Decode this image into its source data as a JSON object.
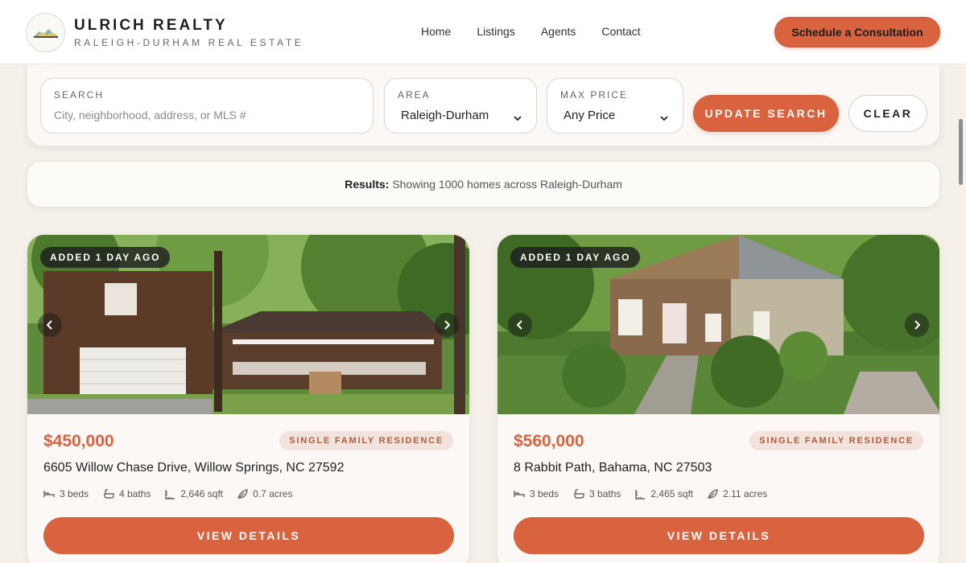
{
  "brand": {
    "name": "ULRICH REALTY",
    "tagline": "RALEIGH-DURHAM REAL ESTATE",
    "logo_icon": "house-logo-icon"
  },
  "nav": {
    "items": [
      {
        "label": "Home"
      },
      {
        "label": "Listings"
      },
      {
        "label": "Agents"
      },
      {
        "label": "Contact"
      }
    ],
    "cta_label": "Schedule a Consultation"
  },
  "search": {
    "search_label": "SEARCH",
    "search_placeholder": "City, neighborhood, address, or MLS #",
    "search_value": "",
    "area_label": "AREA",
    "area_value": "Raleigh-Durham",
    "price_label": "MAX PRICE",
    "price_value": "Any Price",
    "update_label": "UPDATE SEARCH",
    "clear_label": "CLEAR"
  },
  "results": {
    "prefix": "Results:",
    "text": "Showing 1000 homes across Raleigh-Durham"
  },
  "listings": [
    {
      "added": "ADDED 1 DAY AGO",
      "price": "$450,000",
      "type": "SINGLE FAMILY RESIDENCE",
      "address": "6605 Willow Chase Drive, Willow Springs, NC 27592",
      "beds": "3 beds",
      "baths": "4 baths",
      "sqft": "2,646 sqft",
      "acres": "0.7 acres",
      "button": "VIEW DETAILS"
    },
    {
      "added": "ADDED 1 DAY AGO",
      "price": "$560,000",
      "type": "SINGLE FAMILY RESIDENCE",
      "address": "8 Rabbit Path, Bahama, NC 27503",
      "beds": "3 beds",
      "baths": "3 baths",
      "sqft": "2,465 sqft",
      "acres": "2.11 acres",
      "button": "VIEW DETAILS"
    }
  ],
  "colors": {
    "accent": "#d9623f",
    "background": "#f5f0ea",
    "badge_bg": "#f2e4dc"
  }
}
